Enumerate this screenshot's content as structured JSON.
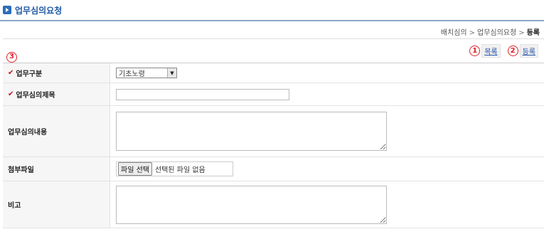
{
  "header": {
    "title": "업무심의요청",
    "title_icon": "play-arrow-icon"
  },
  "breadcrumb": {
    "items": [
      "배치심의",
      "업무심의요청"
    ],
    "current": "등록",
    "separator": ">"
  },
  "actions": {
    "list_label": "목록",
    "list_num": "1",
    "register_label": "등록",
    "register_num": "2"
  },
  "annotation": {
    "required_num": "3"
  },
  "form": {
    "type": {
      "label": "업무구분",
      "value": "기초노령",
      "required": true
    },
    "subject": {
      "label": "업무심의제목",
      "value": "",
      "required": true
    },
    "content": {
      "label": "업무심의내용",
      "value": ""
    },
    "attachment": {
      "label": "첨부파일",
      "button": "파일 선택",
      "status": "선택된 파일 없음"
    },
    "note": {
      "label": "비고",
      "value": ""
    }
  },
  "colors": {
    "accent": "#1f5aa6",
    "required": "#c0121a",
    "annotation": "#e0202a"
  }
}
